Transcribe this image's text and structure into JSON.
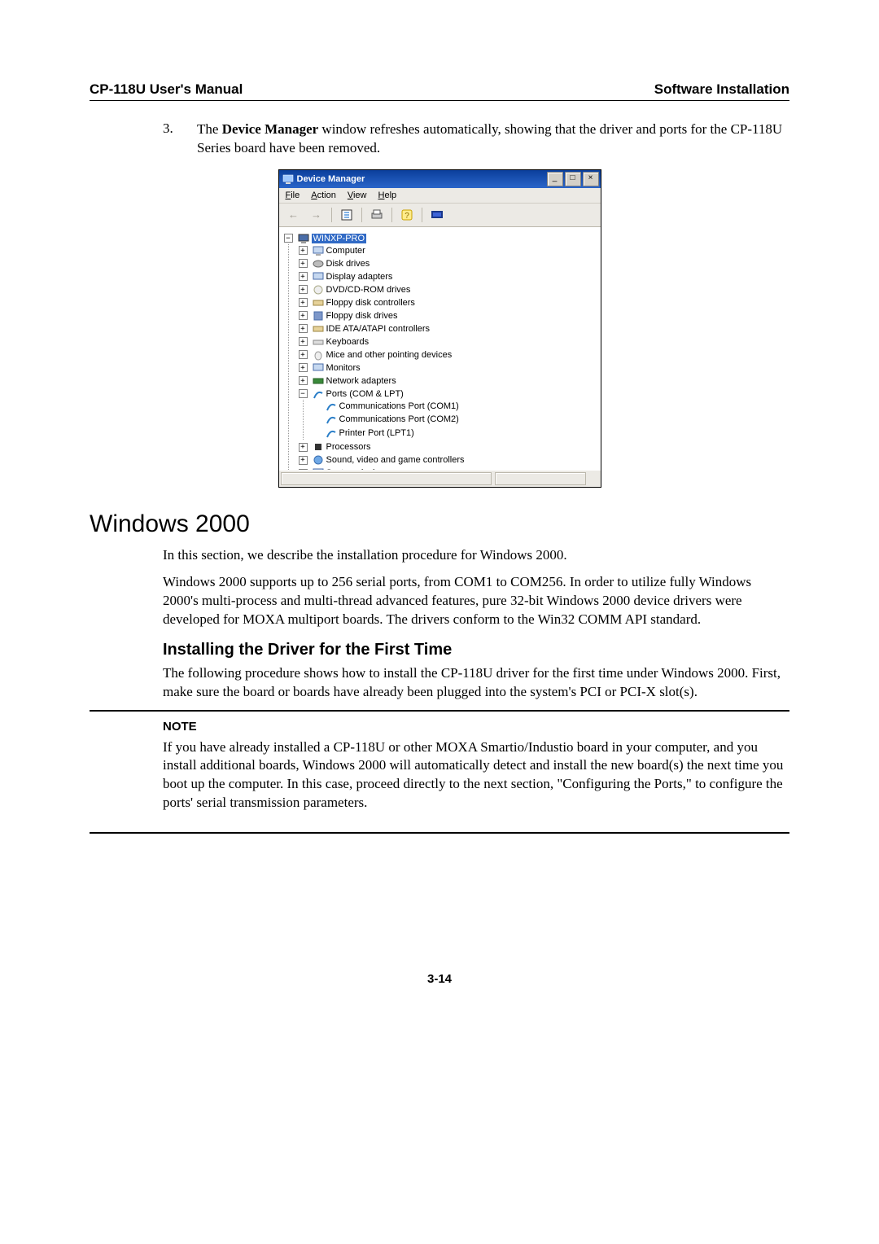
{
  "header": {
    "left": "CP-118U User's Manual",
    "right": "Software Installation"
  },
  "step": {
    "num": "3.",
    "text_a": "The ",
    "text_b": "Device Manager",
    "text_c": " window refreshes automatically, showing that the driver and ports for the CP-118U Series board have been removed."
  },
  "window": {
    "title": "Device Manager",
    "menus": {
      "file": "File",
      "action": "Action",
      "view": "View",
      "help": "Help"
    },
    "win_btns": {
      "min": "_",
      "max": "□",
      "close": "×"
    },
    "root": "WINXP-PRO",
    "items": {
      "computer": "Computer",
      "disk": "Disk drives",
      "display": "Display adapters",
      "dvd": "DVD/CD-ROM drives",
      "floppyctl": "Floppy disk controllers",
      "floppydrv": "Floppy disk drives",
      "ide": "IDE ATA/ATAPI controllers",
      "keyboards": "Keyboards",
      "mice": "Mice and other pointing devices",
      "monitors": "Monitors",
      "network": "Network adapters",
      "ports": "Ports (COM & LPT)",
      "com1": "Communications Port (COM1)",
      "com2": "Communications Port (COM2)",
      "lpt1": "Printer Port (LPT1)",
      "processors": "Processors",
      "sound": "Sound, video and game controllers",
      "system": "System devices"
    }
  },
  "section_title": "Windows 2000",
  "para1": "In this section, we describe the installation procedure for Windows 2000.",
  "para2": "Windows 2000 supports up to 256 serial ports, from COM1 to COM256. In order to utilize fully Windows 2000's multi-process and multi-thread advanced features, pure 32-bit Windows 2000 device drivers were developed for MOXA multiport boards. The drivers conform to the Win32 COMM API standard.",
  "subsection": "Installing the Driver for the First Time",
  "para3": "The following procedure shows how to install the CP-118U driver for the first time under Windows 2000. First, make sure the board or boards have already been plugged into the system's PCI or PCI-X slot(s).",
  "note_label": "NOTE",
  "note_text": "If you have already installed a CP-118U or other MOXA Smartio/Industio board in your computer, and you install additional boards, Windows 2000 will automatically detect and install the new board(s) the next time you boot up the computer. In this case, proceed directly to the next section, \"Configuring the Ports,\" to configure the ports' serial transmission parameters.",
  "page_num": "3-14"
}
